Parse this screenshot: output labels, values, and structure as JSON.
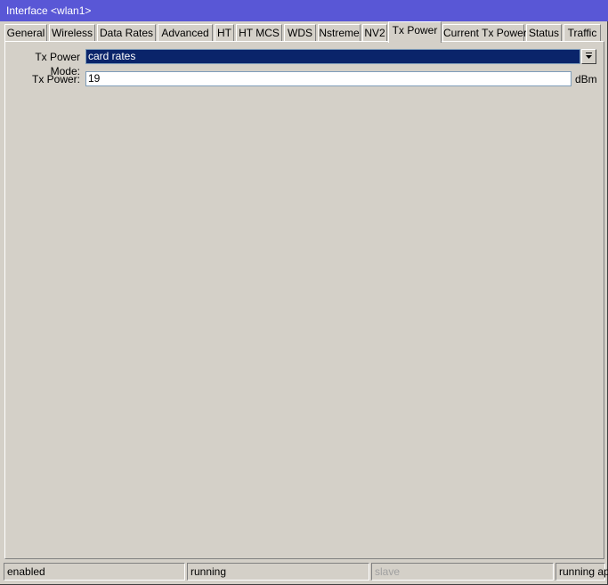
{
  "window": {
    "title": "Interface <wlan1>"
  },
  "tabs": [
    {
      "label": "General"
    },
    {
      "label": "Wireless"
    },
    {
      "label": "Data Rates"
    },
    {
      "label": "Advanced"
    },
    {
      "label": "HT"
    },
    {
      "label": "HT MCS"
    },
    {
      "label": "WDS"
    },
    {
      "label": "Nstreme"
    },
    {
      "label": "NV2"
    },
    {
      "label": "Tx Power"
    },
    {
      "label": "Current Tx Power"
    },
    {
      "label": "Status"
    },
    {
      "label": "Traffic"
    }
  ],
  "active_tab": "Tx Power",
  "form": {
    "tx_power_mode": {
      "label": "Tx Power Mode:",
      "value": "card rates"
    },
    "tx_power": {
      "label": "Tx Power:",
      "value": "19",
      "unit": "dBm"
    }
  },
  "status": {
    "state": "enabled",
    "running": "running",
    "slave": "slave",
    "mode": "running ap"
  },
  "colors": {
    "titlebar": "#5957d6",
    "selected_field": "#0a246a",
    "face": "#d4d0c8"
  }
}
